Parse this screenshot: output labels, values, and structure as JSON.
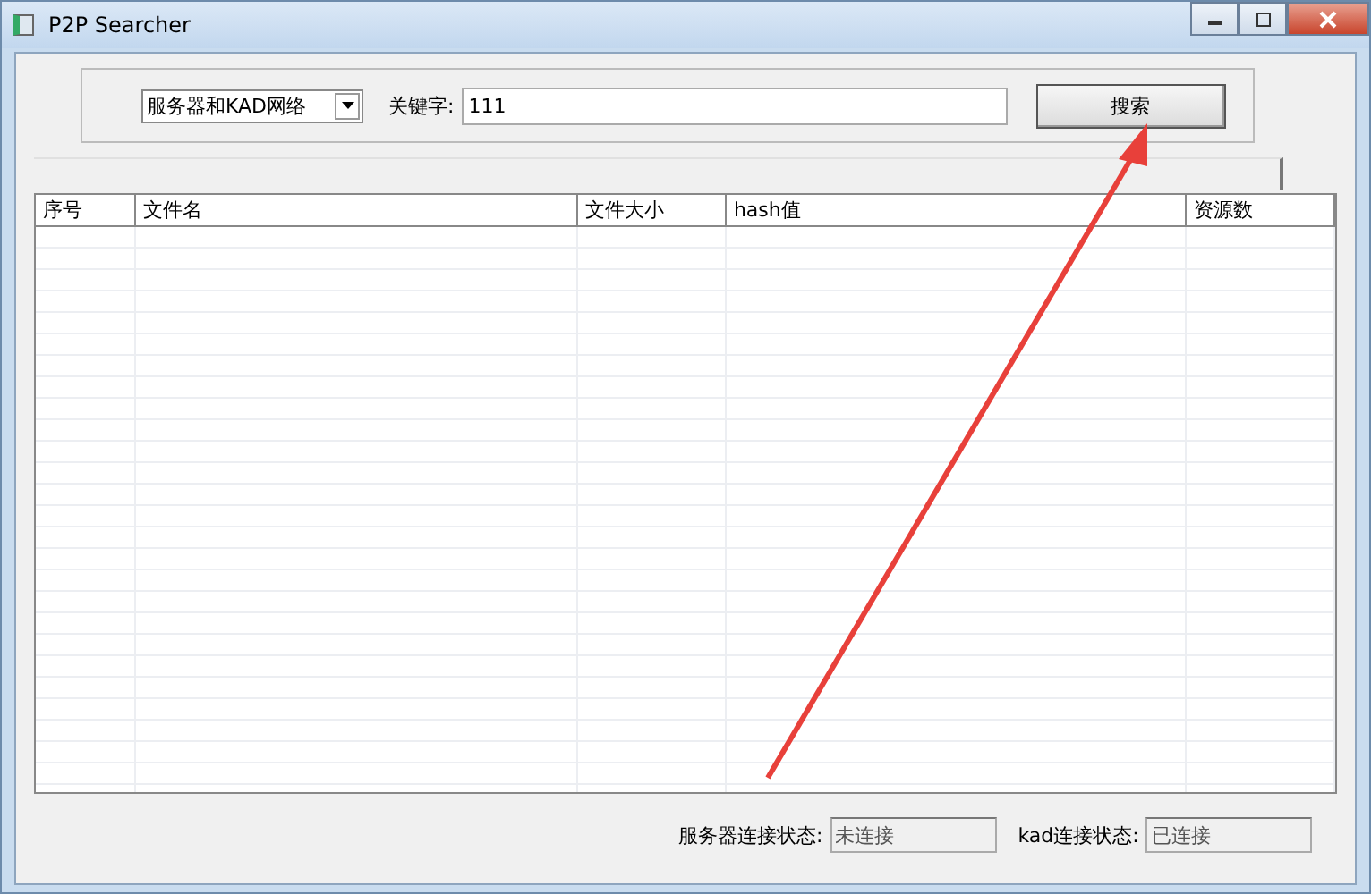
{
  "window": {
    "title": "P2P Searcher"
  },
  "search": {
    "mode": "服务器和KAD网络",
    "keyword_label": "关键字:",
    "keyword": "111",
    "button": "搜索"
  },
  "table": {
    "columns": [
      "序号",
      "文件名",
      "文件大小",
      "hash值",
      "资源数"
    ]
  },
  "status_bar": [
    {
      "label": "服务器连接状态:",
      "value": "未连接"
    },
    {
      "label": "kad连接状态:",
      "value": "已连接"
    }
  ]
}
